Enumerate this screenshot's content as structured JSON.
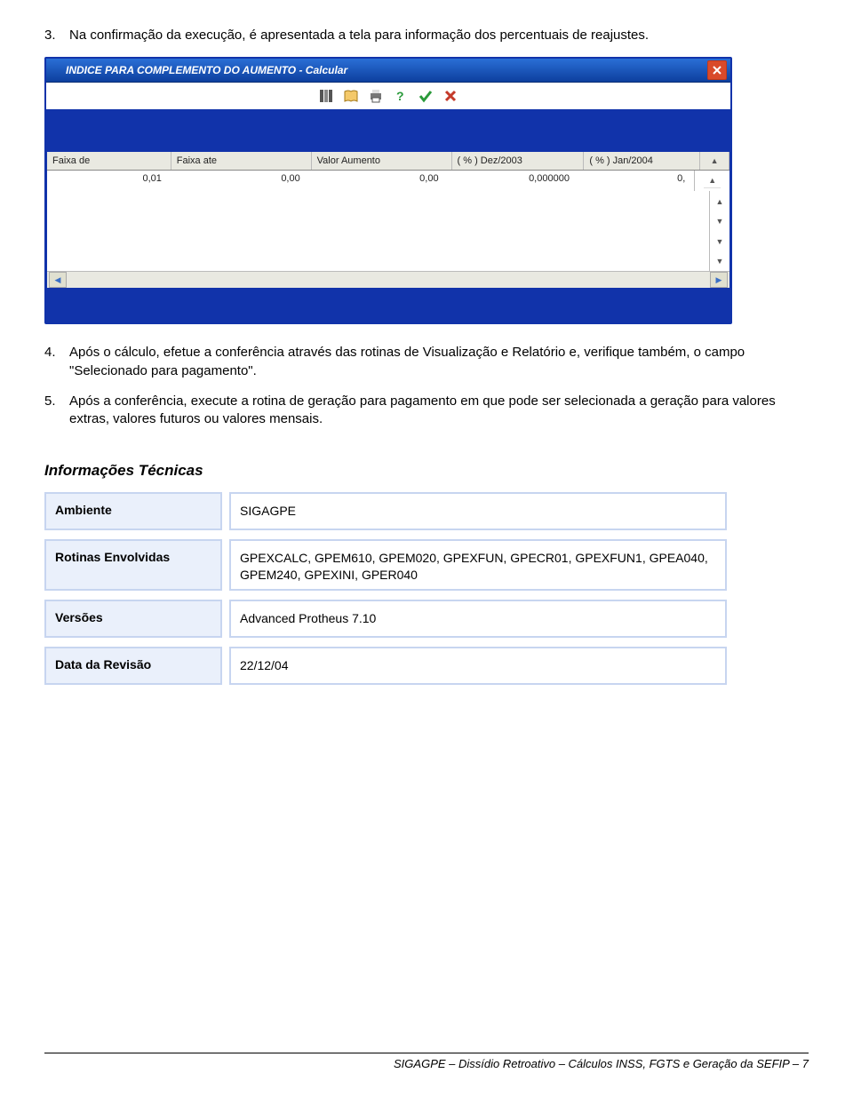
{
  "items": {
    "i3": {
      "num": "3.",
      "text": "Na confirmação da execução, é apresentada a tela para informação dos percentuais de reajustes."
    },
    "i4": {
      "num": "4.",
      "text": "Após o cálculo, efetue a conferência através das rotinas de Visualização e Relatório e, verifique também, o campo \"Selecionado para pagamento\"."
    },
    "i5": {
      "num": "5.",
      "text": "Após a conferência, execute a rotina de geração para pagamento em que pode ser selecionada a geração para valores extras, valores futuros ou valores mensais."
    }
  },
  "screenshot": {
    "title": "INDICE PARA COMPLEMENTO DO AUMENTO - Calcular",
    "grid": {
      "headers": [
        "Faixa de",
        "Faixa ate",
        "Valor Aumento",
        "( % )  Dez/2003",
        "( % )  Jan/2004"
      ],
      "row": [
        "0,01",
        "0,00",
        "0,00",
        "0,000000",
        "0,"
      ]
    }
  },
  "techinfo": {
    "title": "Informações Técnicas",
    "labels": {
      "ambiente": "Ambiente",
      "rotinas": "Rotinas Envolvidas",
      "versoes": "Versões",
      "data": "Data da Revisão"
    },
    "values": {
      "ambiente": "SIGAGPE",
      "rotinas": "GPEXCALC, GPEM610, GPEM020, GPEXFUN, GPECR01, GPEXFUN1, GPEA040, GPEM240, GPEXINI, GPER040",
      "versoes": "Advanced Protheus 7.10",
      "data": "22/12/04"
    }
  },
  "footer": "SIGAGPE – Dissídio Retroativo – Cálculos INSS, FGTS e Geração da SEFIP – 7"
}
